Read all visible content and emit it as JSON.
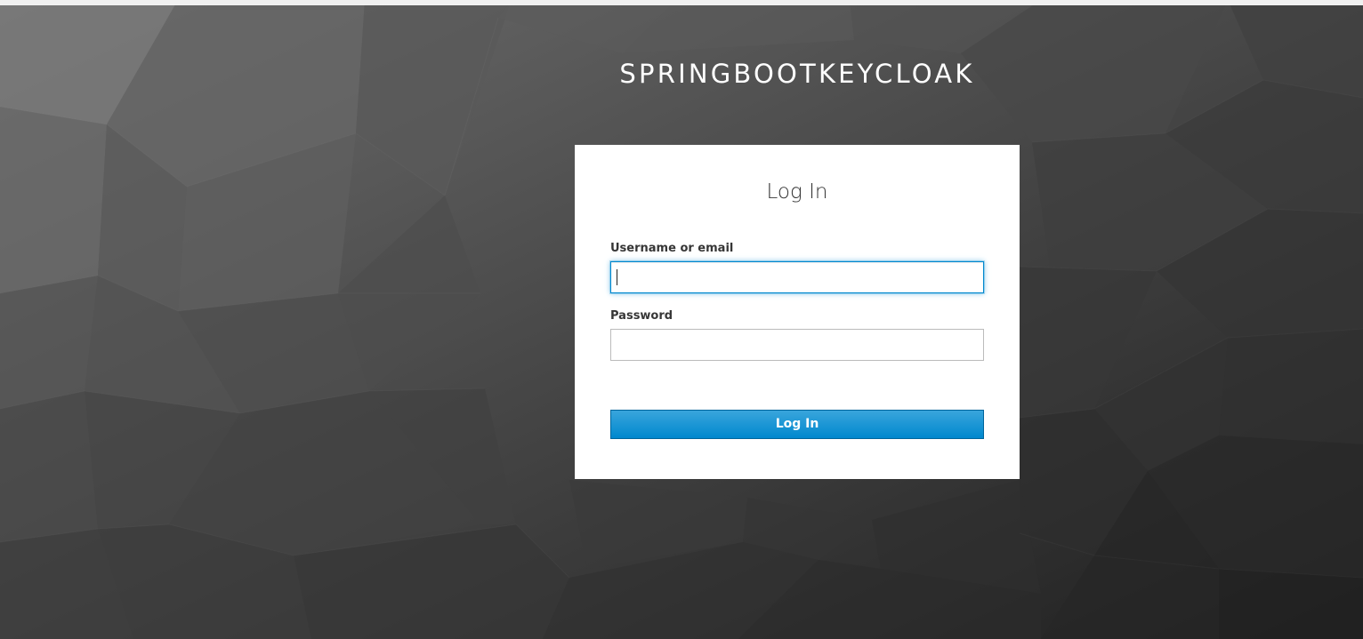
{
  "realm": {
    "title": "SPRINGBOOTKEYCLOAK"
  },
  "login_form": {
    "title": "Log In",
    "username_label": "Username or email",
    "username_value": "",
    "password_label": "Password",
    "password_value": "",
    "submit_label": "Log In"
  },
  "colors": {
    "primary_button": "#0088ce",
    "focus_border": "#0088ce",
    "card_background": "#ffffff",
    "page_background": "#3a3a3a"
  }
}
